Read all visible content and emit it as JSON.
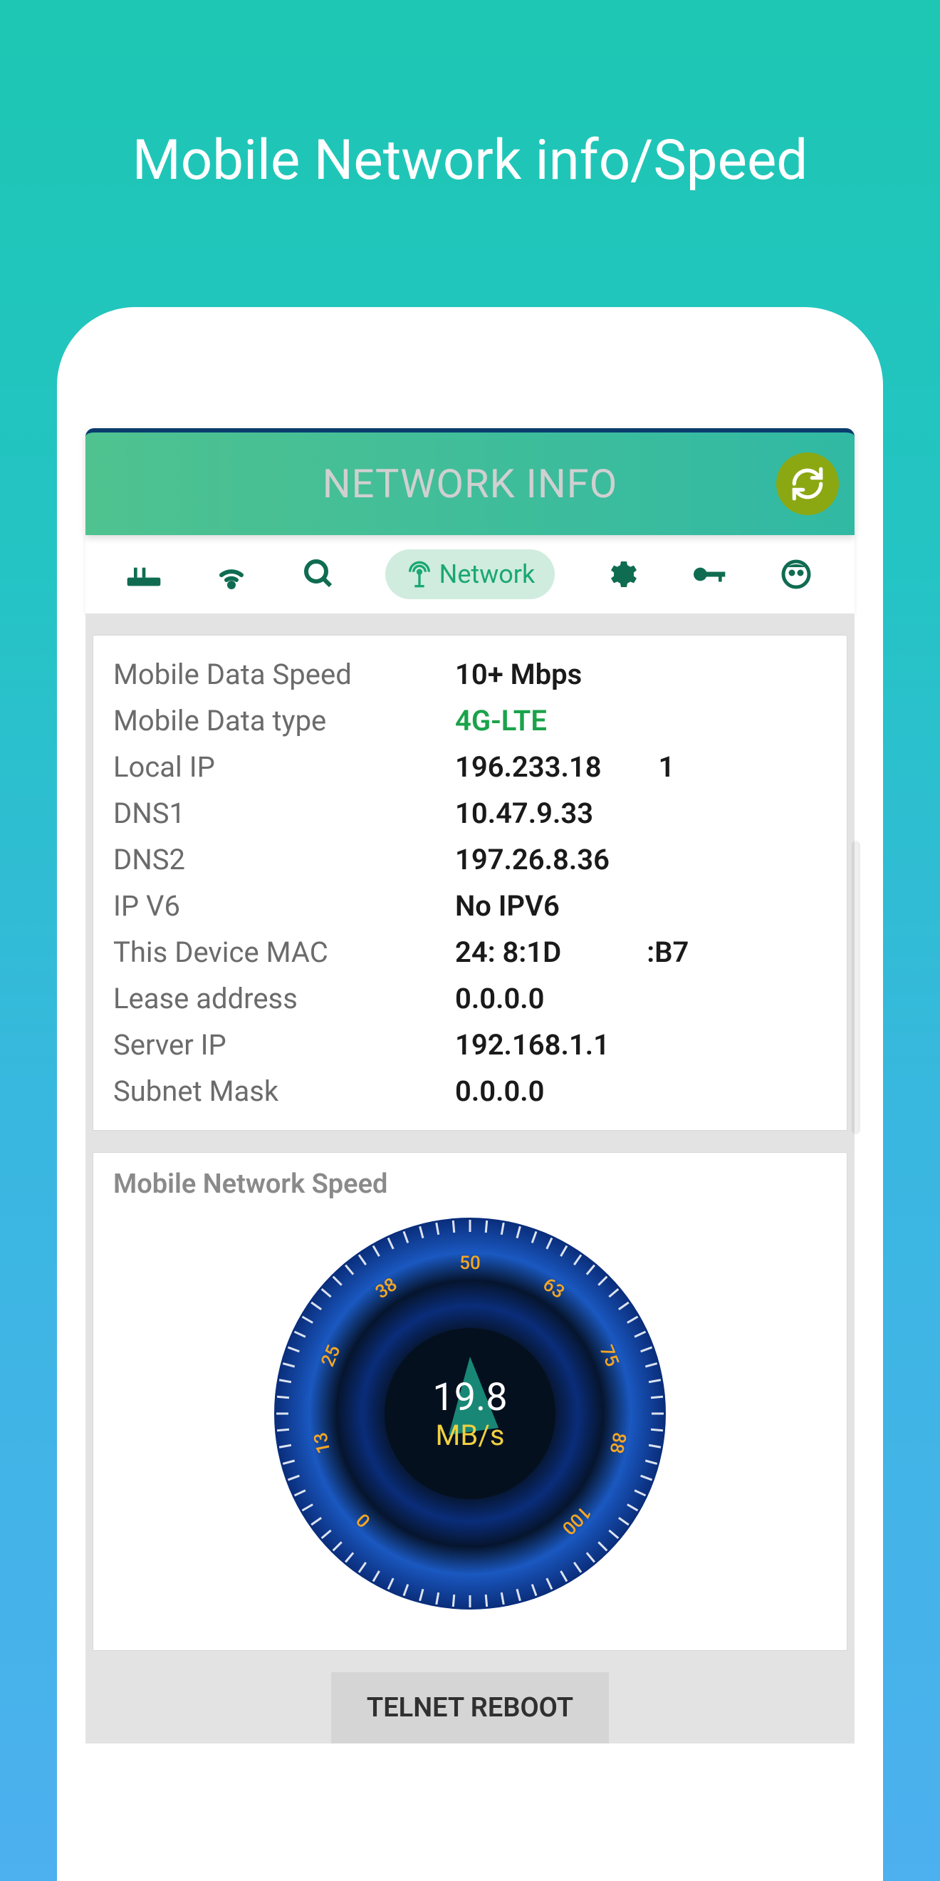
{
  "page": {
    "title": "Mobile Network info/Speed"
  },
  "header": {
    "title": "NETWORK INFO"
  },
  "tabs": {
    "active_label": "Network"
  },
  "info": {
    "rows": [
      {
        "label": "Mobile Data Speed",
        "value": "10+ Mbps",
        "style": "bold"
      },
      {
        "label": "Mobile Data type",
        "value": "4G-LTE",
        "style": "green"
      },
      {
        "label": "Local IP",
        "value": "196.233.18",
        "suffix": "1"
      },
      {
        "label": "DNS1",
        "value": "10.47.9.33"
      },
      {
        "label": "DNS2",
        "value": "197.26.8.36"
      },
      {
        "label": "IP V6",
        "value": "No IPV6"
      },
      {
        "label": "This Device MAC",
        "value": "24:   8:1D",
        "suffix2": ":B7"
      },
      {
        "label": "Lease address",
        "value": "0.0.0.0"
      },
      {
        "label": "Server IP",
        "value": "192.168.1.1"
      },
      {
        "label": "Subnet Mask",
        "value": "0.0.0.0"
      }
    ]
  },
  "gauge": {
    "title": "Mobile Network Speed",
    "value": "19.8",
    "unit": "MB/s",
    "ticks": [
      "0",
      "13",
      "25",
      "38",
      "50",
      "63",
      "75",
      "88",
      "100"
    ]
  },
  "buttons": {
    "telnet_reboot": "TELNET REBOOT"
  },
  "chart_data": {
    "type": "gauge",
    "title": "Mobile Network Speed",
    "value": 19.8,
    "unit": "MB/s",
    "min": 0,
    "max": 100,
    "ticks": [
      0,
      13,
      25,
      38,
      50,
      63,
      75,
      88,
      100
    ]
  }
}
